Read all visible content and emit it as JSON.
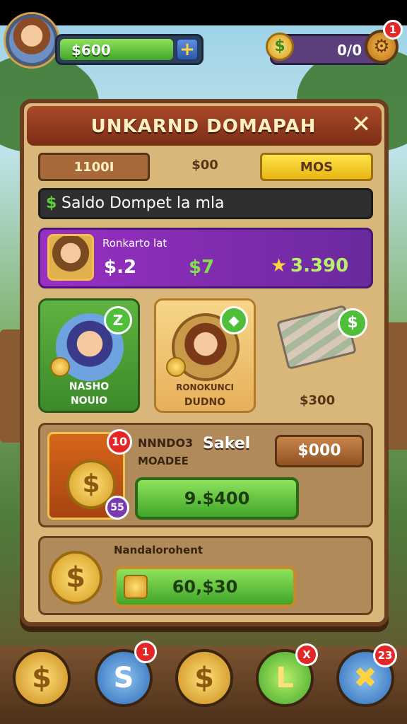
{
  "topbar": {
    "cash_value": "$600",
    "plus_label": "+",
    "coin_value": "0/0",
    "coin_symbol": "$",
    "settings_badge": "1"
  },
  "panel": {
    "title": "UNKARND DOMAPAH",
    "close_label": "✕",
    "tabs": [
      "1100I",
      "$00",
      "MOS"
    ],
    "wallet_icon": "$",
    "wallet_text": "Saldo Dompet la mla",
    "featured": {
      "label": "Ronkarto  lat",
      "value_1": "$.2",
      "value_2": "$7",
      "star": "★",
      "value_3": "3.390"
    },
    "items": [
      {
        "badge": "Z",
        "line1": "NASHO",
        "line2": "NOUIO"
      },
      {
        "badge": "⬥",
        "line1": "RONOKUNCI",
        "line2": "DUDNO"
      },
      {
        "badge": "$",
        "label": "$300"
      }
    ],
    "offer": {
      "badge_count": "10",
      "badge_small": "55",
      "coin_symbol": "$",
      "title": "NNNDO3",
      "title_2": "Sakel",
      "subtitle": "MOADEE",
      "price": "$000",
      "buy_label": "9.$400"
    },
    "reward": {
      "label": "Nandalorohent",
      "coin_symbol": "$",
      "button_label": "60,$30"
    }
  },
  "bottom_nav": [
    {
      "icon": "$",
      "badge": ""
    },
    {
      "icon": "S",
      "badge": "1"
    },
    {
      "icon": "$",
      "badge": ""
    },
    {
      "icon": "L",
      "badge": "X"
    },
    {
      "icon": "✖",
      "badge": "23"
    }
  ]
}
